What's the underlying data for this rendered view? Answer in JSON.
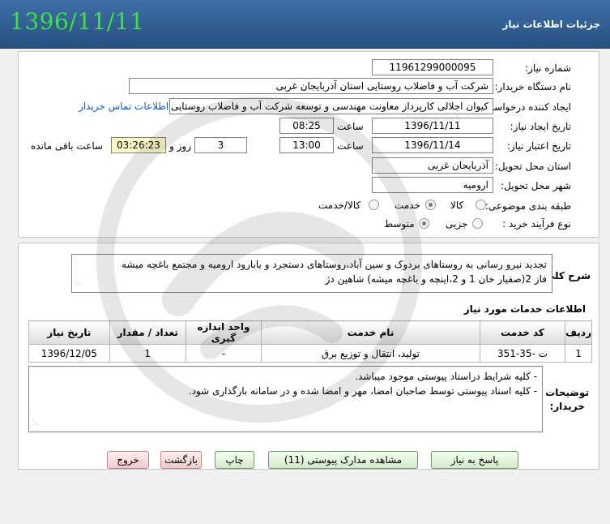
{
  "header": {
    "date": "1396/11/11",
    "title": "جزئیات اطلاعات نیاز"
  },
  "form": {
    "need_number_label": "شماره نیاز:",
    "need_number": "11961299000095",
    "buyer_org_label": "نام دستگاه خریدار:",
    "buyer_org": "شرکت آب و فاضلاب روستایی استان آذربایجان غربی",
    "creator_label": "ایجاد کننده درخواست:",
    "creator": "کیوان اجلالی کارپرداز معاونت مهندسی و توسعه شرکت آب و فاضلاب روستایی",
    "contact_link": "اطلاعات تماس خریدار",
    "created_date_label": "تاریخ ایجاد نیاز:",
    "created_date": "1396/11/11",
    "time_label": "ساعت",
    "created_time": "08:25",
    "validity_label": "تاریخ اعتبار نیاز:",
    "validity_date": "1396/11/14",
    "validity_time": "13:00",
    "days_value": "3",
    "days_label": "روز و",
    "remaining_time": "03:26:23",
    "remaining_label": "ساعت باقی مانده",
    "province_label": "استان محل تحویل:",
    "province": "آذربایجان غربی",
    "city_label": "شهر محل تحویل:",
    "city": "ارومیه",
    "category_label": "طبقه بندی موضوعی:",
    "category_options": [
      "کالا",
      "خدمت",
      "کالا/خدمت"
    ],
    "category_selected": "خدمت",
    "process_label": "نوع فرآیند خرید :",
    "process_options": [
      "جزیی",
      "متوسط"
    ],
    "process_selected": "متوسط"
  },
  "description": {
    "label": "شرح کلی نیاز:",
    "line1": "تجدید نیرو رسانی به روستاهای بردوک و سین آباد،روستاهای دستجرد و بابارود ارومیه و مجتمع باغچه میشه",
    "line2": "فاز 2(صفیار خان 1 و 2،اینچه و باغچه میشه) شاهین دژ"
  },
  "services": {
    "title": "اطلاعات خدمات مورد نیاز",
    "columns": [
      "ردیف",
      "کد خدمت",
      "نام خدمت",
      "واحد اندازه گیری",
      "تعداد / مقدار",
      "تاریخ نیاز"
    ],
    "rows": [
      [
        "1",
        "ت -35-351",
        "تولید، انتقال و توزیع برق",
        "-",
        "1",
        "1396/12/05"
      ]
    ]
  },
  "buyer_notes": {
    "label_line1": "توضیحات",
    "label_line2": "خریدار:",
    "line1": "- کلیه شرایط دراسناد پیوستی موجود میباشد.",
    "line2": "- کلیه اسناد پیوستی توسط صاحبان امضا، مهر و امضا شده و در سامانه بارگذاری شود."
  },
  "buttons": {
    "reply": "پاسخ به نیاز",
    "attachments": "مشاهده مدارک پیوستی (11)",
    "print": "چاپ",
    "back": "بازگشت",
    "exit": "خروج"
  }
}
